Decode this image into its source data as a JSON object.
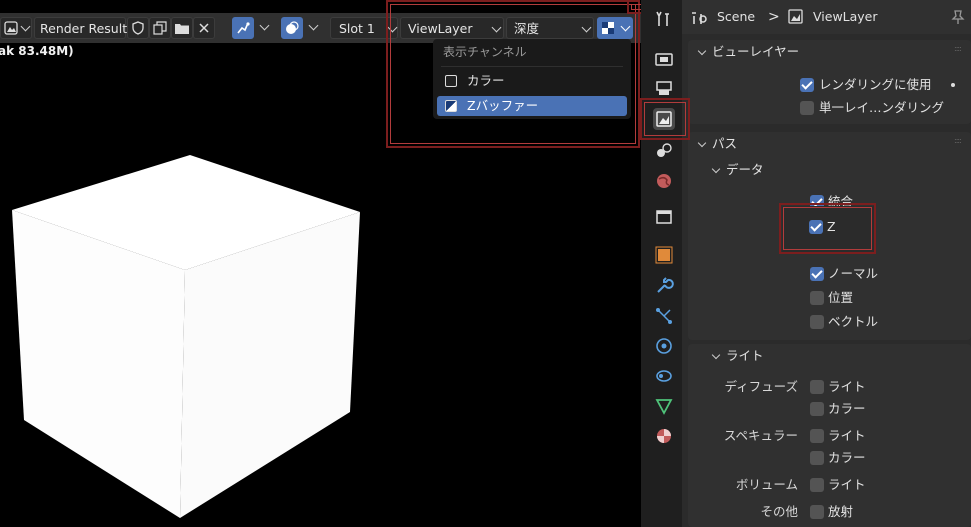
{
  "header": {
    "image_name": "Render Result",
    "slot": "Slot 1",
    "view_layer": "ViewLayer",
    "pass": "深度"
  },
  "status": {
    "text": "ak 83.48M)"
  },
  "dropdown": {
    "title": "表示チャンネル",
    "items": [
      {
        "label": "カラー",
        "selected": false
      },
      {
        "label": "Zバッファー",
        "selected": true
      }
    ]
  },
  "properties": {
    "breadcrumb": {
      "scene": "Scene",
      "separator": ">",
      "view_layer": "ViewLayer"
    },
    "view_layer_panel": {
      "title": "ビューレイヤー",
      "use_for_rendering": {
        "label": "レンダリングに使用",
        "checked": true
      },
      "render_single_layer": {
        "label": "単一レイ…ンダリング",
        "checked": false
      }
    },
    "passes_panel": {
      "title": "パス",
      "data": {
        "title": "データ",
        "combined": {
          "label": "統合",
          "checked": true
        },
        "z": {
          "label": "Z",
          "checked": true
        },
        "normal": {
          "label": "ノーマル",
          "checked": true
        },
        "position": {
          "label": "位置",
          "checked": false
        },
        "vector": {
          "label": "ベクトル",
          "checked": false
        }
      },
      "light": {
        "title": "ライト",
        "diffuse": {
          "label": "ディフューズ",
          "light": "ライト",
          "color": "カラー"
        },
        "specular": {
          "label": "スペキュラー",
          "light": "ライト",
          "color": "カラー"
        },
        "volume": {
          "label": "ボリューム",
          "light": "ライト"
        },
        "other": {
          "label": "その他",
          "emission": "放射"
        }
      }
    }
  },
  "colors": {
    "accent": "#4a72b5",
    "highlight": "#8b1e1e",
    "panel": "#303030",
    "background": "#2b2b2b"
  }
}
